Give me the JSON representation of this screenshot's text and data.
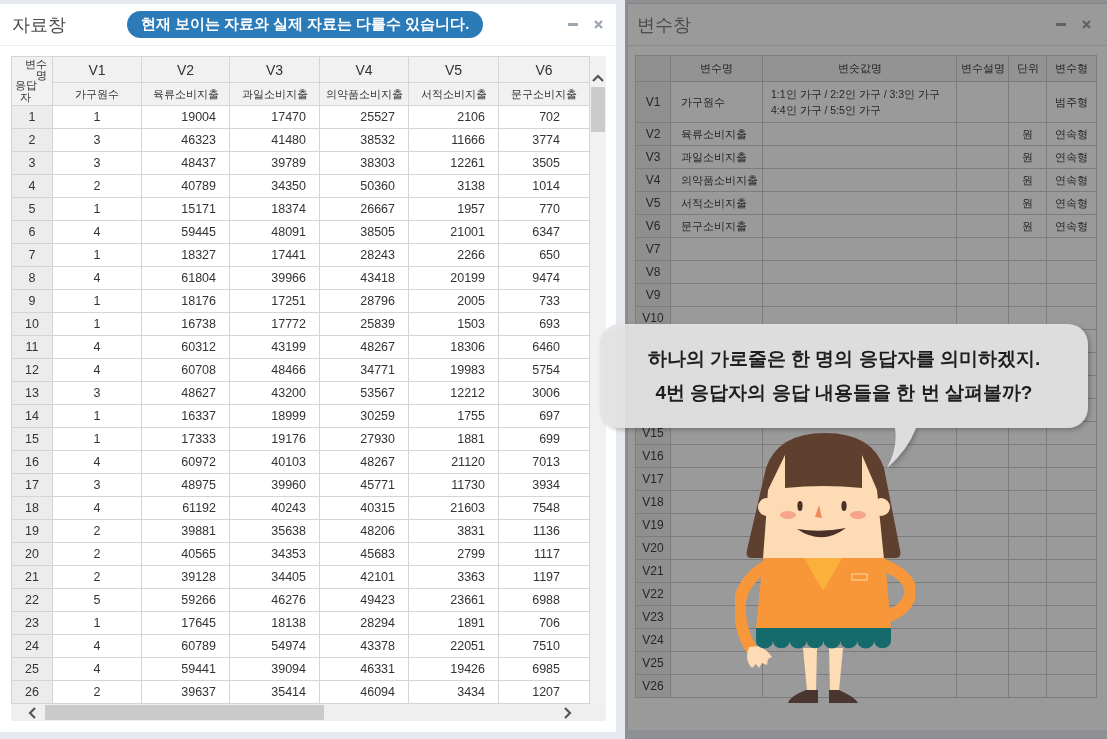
{
  "data_window": {
    "title": "자료창",
    "notice": "현재 보이는 자료와 실제 자료는 다를수 있습니다.",
    "corner": {
      "top": "변수명",
      "bottom": "응답자"
    },
    "columns": [
      {
        "name": "V1",
        "label": "가구원수"
      },
      {
        "name": "V2",
        "label": "육류소비지출"
      },
      {
        "name": "V3",
        "label": "과일소비지출"
      },
      {
        "name": "V4",
        "label": "의약품소비지출"
      },
      {
        "name": "V5",
        "label": "서적소비지출"
      },
      {
        "name": "V6",
        "label": "문구소비지출"
      }
    ],
    "rows": [
      {
        "index": "1",
        "values": [
          "1",
          "19004",
          "17470",
          "25527",
          "2106",
          "702"
        ]
      },
      {
        "index": "2",
        "values": [
          "3",
          "46323",
          "41480",
          "38532",
          "11666",
          "3774"
        ]
      },
      {
        "index": "3",
        "values": [
          "3",
          "48437",
          "39789",
          "38303",
          "12261",
          "3505"
        ]
      },
      {
        "index": "4",
        "values": [
          "2",
          "40789",
          "34350",
          "50360",
          "3138",
          "1014"
        ]
      },
      {
        "index": "5",
        "values": [
          "1",
          "15171",
          "18374",
          "26667",
          "1957",
          "770"
        ]
      },
      {
        "index": "6",
        "values": [
          "4",
          "59445",
          "48091",
          "38505",
          "21001",
          "6347"
        ]
      },
      {
        "index": "7",
        "values": [
          "1",
          "18327",
          "17441",
          "28243",
          "2266",
          "650"
        ]
      },
      {
        "index": "8",
        "values": [
          "4",
          "61804",
          "39966",
          "43418",
          "20199",
          "9474"
        ]
      },
      {
        "index": "9",
        "values": [
          "1",
          "18176",
          "17251",
          "28796",
          "2005",
          "733"
        ]
      },
      {
        "index": "10",
        "values": [
          "1",
          "16738",
          "17772",
          "25839",
          "1503",
          "693"
        ]
      },
      {
        "index": "11",
        "values": [
          "4",
          "60312",
          "43199",
          "48267",
          "18306",
          "6460"
        ]
      },
      {
        "index": "12",
        "values": [
          "4",
          "60708",
          "48466",
          "34771",
          "19983",
          "5754"
        ]
      },
      {
        "index": "13",
        "values": [
          "3",
          "48627",
          "43200",
          "53567",
          "12212",
          "3006"
        ]
      },
      {
        "index": "14",
        "values": [
          "1",
          "16337",
          "18999",
          "30259",
          "1755",
          "697"
        ]
      },
      {
        "index": "15",
        "values": [
          "1",
          "17333",
          "19176",
          "27930",
          "1881",
          "699"
        ]
      },
      {
        "index": "16",
        "values": [
          "4",
          "60972",
          "40103",
          "48267",
          "21120",
          "7013"
        ]
      },
      {
        "index": "17",
        "values": [
          "3",
          "48975",
          "39960",
          "45771",
          "11730",
          "3934"
        ]
      },
      {
        "index": "18",
        "values": [
          "4",
          "61192",
          "40243",
          "40315",
          "21603",
          "7548"
        ]
      },
      {
        "index": "19",
        "values": [
          "2",
          "39881",
          "35638",
          "48206",
          "3831",
          "1136"
        ]
      },
      {
        "index": "20",
        "values": [
          "2",
          "40565",
          "34353",
          "45683",
          "2799",
          "1117"
        ]
      },
      {
        "index": "21",
        "values": [
          "2",
          "39128",
          "34405",
          "42101",
          "3363",
          "1197"
        ]
      },
      {
        "index": "22",
        "values": [
          "5",
          "59266",
          "46276",
          "49423",
          "23661",
          "6988"
        ]
      },
      {
        "index": "23",
        "values": [
          "1",
          "17645",
          "18138",
          "28294",
          "1891",
          "706"
        ]
      },
      {
        "index": "24",
        "values": [
          "4",
          "60789",
          "54974",
          "43378",
          "22051",
          "7510"
        ]
      },
      {
        "index": "25",
        "values": [
          "4",
          "59441",
          "39094",
          "46331",
          "19426",
          "6985"
        ]
      },
      {
        "index": "26",
        "values": [
          "2",
          "39637",
          "35414",
          "46094",
          "3434",
          "1207"
        ]
      }
    ]
  },
  "variable_window": {
    "title": "변수창",
    "columns": [
      "변수명",
      "변숫값명",
      "변수설명",
      "단위",
      "변수형"
    ],
    "rows": [
      {
        "id": "V1",
        "name": "가구원수",
        "value_labels": "1:1인 가구 / 2:2인 가구 / 3:3인 가구\n4:4인 가구 / 5:5인 가구",
        "type": "범주형"
      },
      {
        "id": "V2",
        "name": "육류소비지출",
        "unit": "원",
        "type": "연속형"
      },
      {
        "id": "V3",
        "name": "과일소비지출",
        "unit": "원",
        "type": "연속형"
      },
      {
        "id": "V4",
        "name": "의약품소비지출",
        "unit": "원",
        "type": "연속형"
      },
      {
        "id": "V5",
        "name": "서적소비지출",
        "unit": "원",
        "type": "연속형"
      },
      {
        "id": "V6",
        "name": "문구소비지출",
        "unit": "원",
        "type": "연속형"
      },
      {
        "id": "V7"
      },
      {
        "id": "V8"
      },
      {
        "id": "V9"
      },
      {
        "id": "V10"
      },
      {},
      {},
      {},
      {},
      {
        "id": "V15"
      },
      {
        "id": "V16"
      },
      {
        "id": "V17"
      },
      {
        "id": "V18"
      },
      {
        "id": "V19"
      },
      {
        "id": "V20"
      },
      {
        "id": "V21"
      },
      {
        "id": "V22"
      },
      {
        "id": "V23"
      },
      {
        "id": "V24"
      },
      {
        "id": "V25"
      },
      {
        "id": "V26"
      }
    ]
  },
  "speech_bubble": {
    "lines": [
      "**하나의 가로줄은 한 명의 응답자**를 의미하겠지.",
      "4번 응답자의 응답 내용들을 한 번 살펴볼까?"
    ]
  }
}
